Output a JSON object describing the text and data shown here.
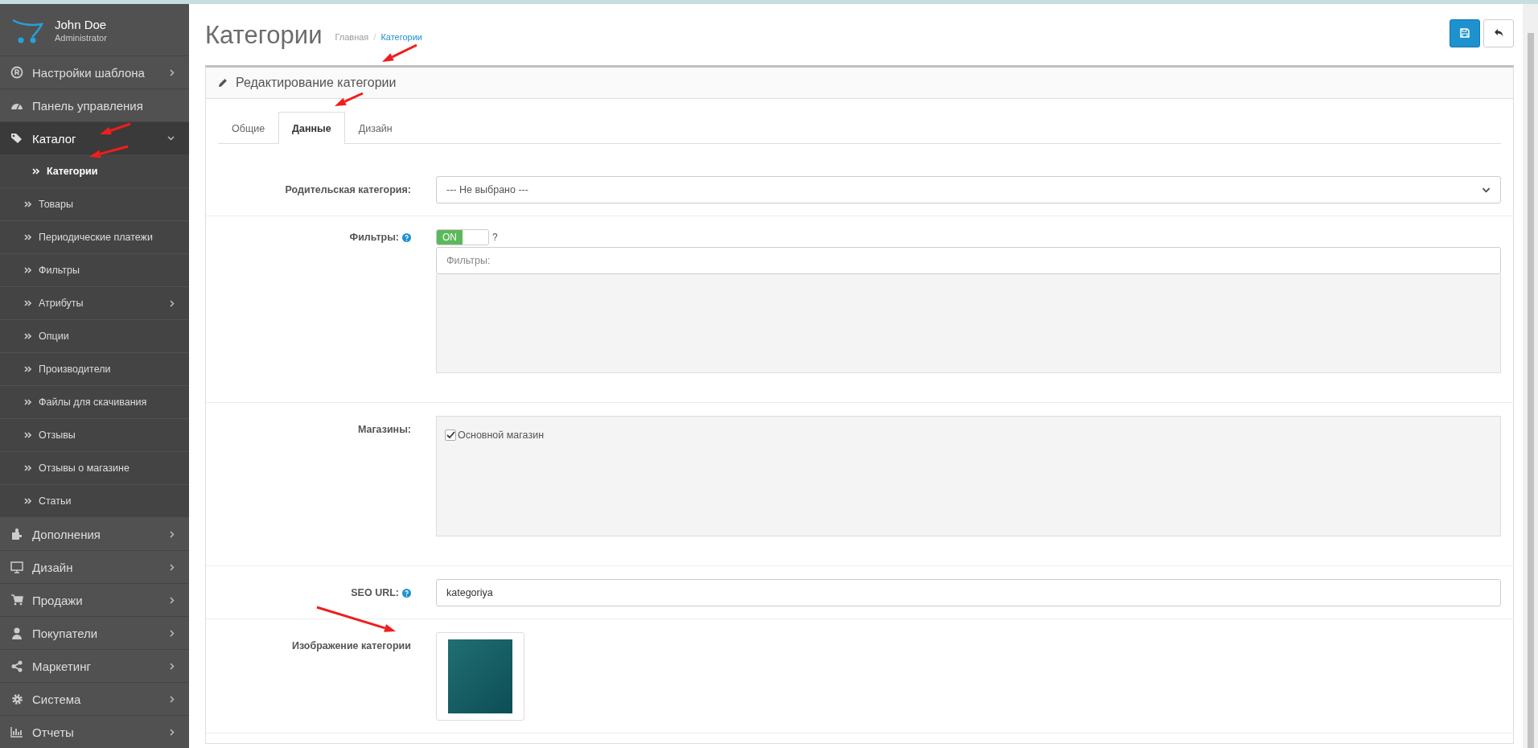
{
  "user": {
    "name": "John Doe",
    "role": "Administrator"
  },
  "sidebar": {
    "items": [
      {
        "label": "Настройки шаблона",
        "expandable": true,
        "expanded": false,
        "selected": false
      },
      {
        "label": "Панель управления",
        "expandable": false,
        "selected": false
      },
      {
        "label": "Каталог",
        "expandable": true,
        "expanded": true,
        "selected": true,
        "children": [
          {
            "label": "Категории",
            "selected": true,
            "expandable": false
          },
          {
            "label": "Товары",
            "selected": false,
            "expandable": false
          },
          {
            "label": "Периодические платежи",
            "selected": false,
            "expandable": false
          },
          {
            "label": "Фильтры",
            "selected": false,
            "expandable": false
          },
          {
            "label": "Атрибуты",
            "selected": false,
            "expandable": true
          },
          {
            "label": "Опции",
            "selected": false,
            "expandable": false
          },
          {
            "label": "Производители",
            "selected": false,
            "expandable": false
          },
          {
            "label": "Файлы для скачивания",
            "selected": false,
            "expandable": false
          },
          {
            "label": "Отзывы",
            "selected": false,
            "expandable": false
          },
          {
            "label": "Отзывы о магазине",
            "selected": false,
            "expandable": false
          },
          {
            "label": "Статьи",
            "selected": false,
            "expandable": false
          }
        ]
      },
      {
        "label": "Дополнения",
        "expandable": true,
        "expanded": false,
        "selected": false
      },
      {
        "label": "Дизайн",
        "expandable": true,
        "expanded": false,
        "selected": false
      },
      {
        "label": "Продажи",
        "expandable": true,
        "expanded": false,
        "selected": false
      },
      {
        "label": "Покупатели",
        "expandable": true,
        "expanded": false,
        "selected": false
      },
      {
        "label": "Маркетинг",
        "expandable": true,
        "expanded": false,
        "selected": false
      },
      {
        "label": "Система",
        "expandable": true,
        "expanded": false,
        "selected": false
      },
      {
        "label": "Отчеты",
        "expandable": true,
        "expanded": false,
        "selected": false
      }
    ]
  },
  "page": {
    "title": "Категории",
    "separator": "/",
    "breadcrumbs": [
      {
        "label": "Главная",
        "current": false
      },
      {
        "label": "Категории",
        "current": true
      }
    ]
  },
  "panel": {
    "title": "Редактирование категории",
    "tabs": [
      {
        "label": "Общие",
        "selected": false
      },
      {
        "label": "Данные",
        "selected": true
      },
      {
        "label": "Дизайн",
        "selected": false
      }
    ],
    "rows": [
      {
        "kind": "select",
        "label": "Родительская категория:",
        "help": false,
        "value": "--- Не выбрано ---"
      },
      {
        "kind": "filters",
        "label": "Фильтры:",
        "help": true,
        "toggle": {
          "label": "ON",
          "on": true
        },
        "toggle_hint": "?",
        "placeholder": "Фильтры:"
      },
      {
        "kind": "stores",
        "label": "Магазины:",
        "help": false,
        "stores": [
          {
            "label": "Основной магазин",
            "checked": true
          }
        ]
      },
      {
        "kind": "text",
        "label": "SEO URL:",
        "help": true,
        "value": "kategoriya"
      },
      {
        "kind": "image",
        "label": "Изображение категории",
        "help": false
      }
    ]
  }
}
